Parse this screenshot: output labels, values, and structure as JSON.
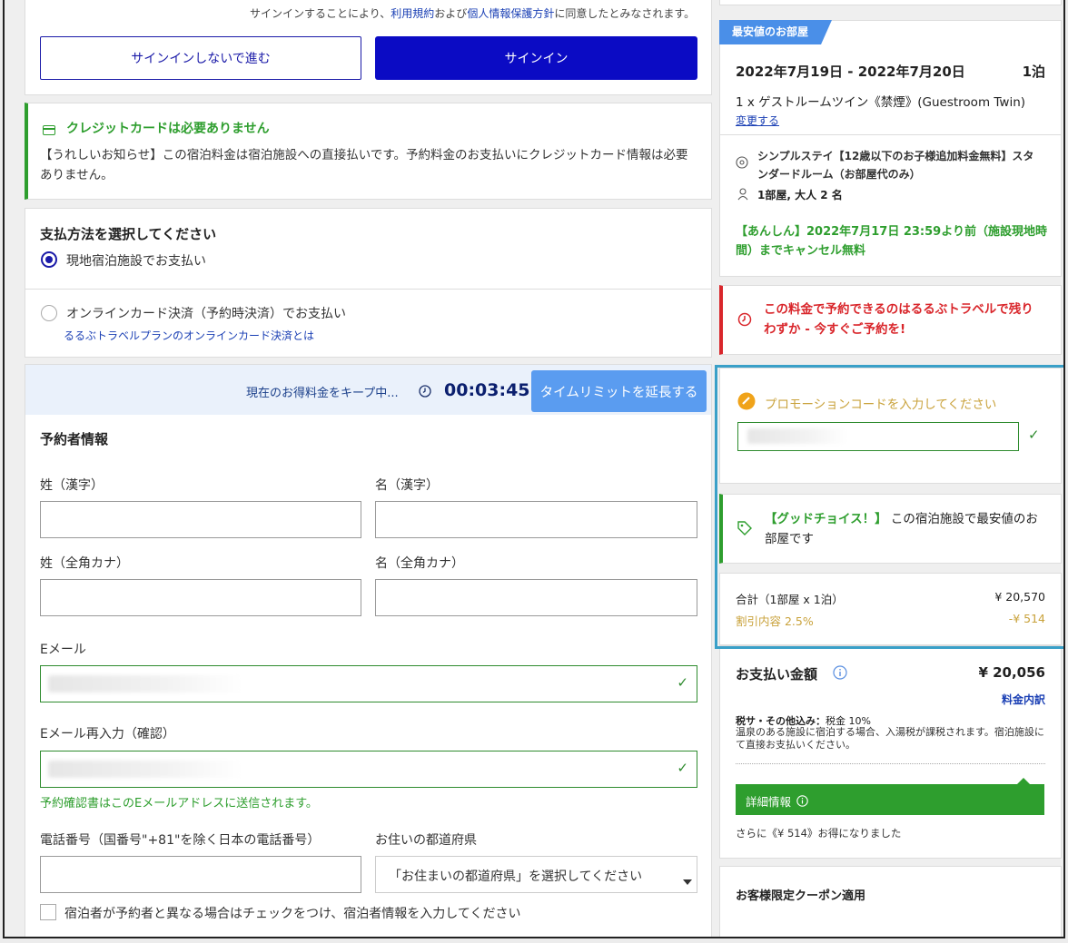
{
  "signin": {
    "notice_prefix": "サインインすることにより、",
    "terms_link": "利用規約",
    "notice_and": "および",
    "privacy_link": "個人情報保護方針",
    "notice_suffix": "に同意したとみなされます。",
    "skip_label": "サインインしないで進む",
    "signin_label": "サインイン"
  },
  "credit_notice": {
    "title": "クレジットカードは必要ありません",
    "body": "【うれしいお知らせ】この宿泊料金は宿泊施設への直接払いです。予約料金のお支払いにクレジットカード情報は必要ありません。",
    "accent_color": "#2e9e2e"
  },
  "payment": {
    "heading": "支払方法を選択してください",
    "option_onsite": "現地宿泊施設でお支払い",
    "option_online": "オンラインカード決済（予約時決済）でお支払い",
    "online_link": "るるぶトラベルプランのオンラインカード決済とは"
  },
  "timer": {
    "keep_text": "現在のお得料金をキープ中...",
    "time": "00:03:45",
    "extend_label": "タイムリミットを延長する"
  },
  "booker": {
    "heading": "予約者情報",
    "last_kanji_label": "姓（漢字）",
    "first_kanji_label": "名（漢字）",
    "last_kana_label": "姓（全角カナ）",
    "first_kana_label": "名（全角カナ）",
    "email_label": "Eメール",
    "email_confirm_label": "Eメール再入力（確認）",
    "email_hint": "予約確認書はこのEメールアドレスに送信されます。",
    "phone_label": "電話番号（国番号\"+81\"を除く日本の電話番号）",
    "pref_label": "お住いの都道府県",
    "pref_value": "「お住まいの都道府県」を選択してください",
    "guest_diff_label": "宿泊者が予約者と異なる場合はチェックをつけ、宿泊者情報を入力してください"
  },
  "room": {
    "badge": "最安値のお部屋",
    "dates": "2022年7月19日 - 2022年7月20日",
    "nights": "1泊",
    "room_name": "1 x ゲストルームツイン《禁煙》(Guestroom Twin)",
    "change_link": "変更する",
    "plan": "シンプルステイ【12歳以下のお子様追加料金無料】スタンダードルーム（お部屋代のみ）",
    "guests": "1部屋, 大人 2 名",
    "cancel": "【あんしん】2022年7月17日 23:59より前（施設現地時間）までキャンセル無料"
  },
  "alert": {
    "text": "この料金で予約できるのはるるぶトラベルで残りわずか - 今すぐご予約を!"
  },
  "promo": {
    "label": "プロモーションコードを入力してください"
  },
  "good_choice": {
    "highlight": "【グッドチョイス！】",
    "text": "この宿泊施設で最安値のお部屋です"
  },
  "price": {
    "total_label": "合計（1部屋 x 1泊）",
    "total_value": "¥ 20,570",
    "discount_label": "割引内容 2.5%",
    "discount_value": "-¥ 514",
    "pay_label": "お支払い金額",
    "pay_value": "¥ 20,056",
    "breakdown_link": "料金内訳",
    "tax_bold": "税サ・その他込み：",
    "tax_text": "税金 10%",
    "onsen_note": "温泉のある施設に宿泊する場合、入湯税が課税されます。宿泊施設にて直接お支払いください。",
    "details_label": "詳細情報",
    "savings_note": "さらに《¥ 514》お得になりました"
  },
  "coupon": {
    "heading": "お客様限定クーポン適用"
  }
}
